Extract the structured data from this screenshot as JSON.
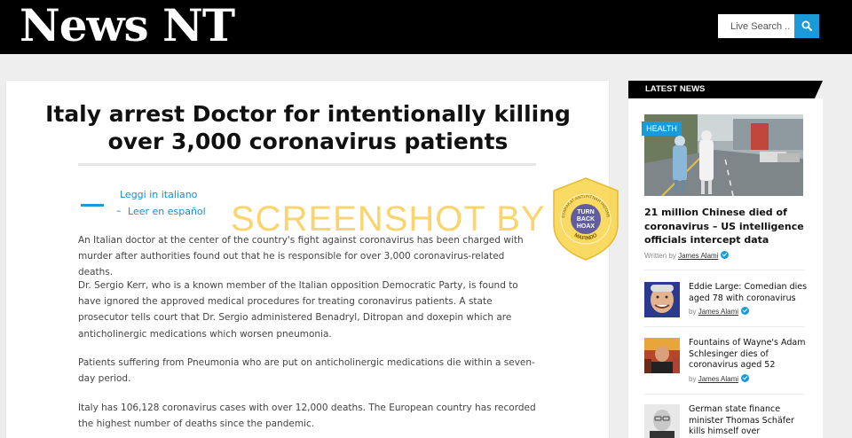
{
  "header": {
    "logo": "News NT",
    "search_placeholder": "Live Search ..",
    "search_icon": "magnifier-icon"
  },
  "article": {
    "title": "Italy arrest Doctor for intentionally killing over 3,000 coronavirus patients",
    "languages": [
      {
        "label": "Leggi in italiano"
      },
      {
        "label": "Leer en español"
      }
    ],
    "paragraphs": [
      "An Italian doctor at the center of the country's fight against coronavirus has been charged with murder after authorities found out that he is responsible for over 3,000 coronavirus-related deaths.",
      "Dr. Sergio Kerr, who is a known member of the Italian opposition Democratic Party, is found to have ignored the approved medical procedures for treating coronavirus patients. A state prosecutor tells court that Dr. Sergio administered Benadryl, Ditropan and doxepin which are anticholinergic medications which worsen pneumonia.",
      "Patients suffering from Pneumonia who are put on anticholinergic medications die within a seven-day period.",
      "Italy has 106,128 coronavirus cases with over 12,000 deaths. The European country has recorded the highest number of deaths since the pandemic."
    ]
  },
  "watermark": {
    "text": "SCREENSHOT BY",
    "seal_top": "MASYARAKAT ANTI FITNAH INDONESIA",
    "seal_center": [
      "TURN",
      "BACK",
      "HOAX"
    ],
    "seal_bottom": "MAFINDO"
  },
  "sidebar": {
    "heading": "LATEST NEWS",
    "featured": {
      "tag": "HEALTH",
      "title": "21 million Chinese died of coronavirus – US intelligence officials intercept data",
      "written_by": "Written by",
      "author": "James Alami"
    },
    "items": [
      {
        "title": "Eddie Large: Comedian dies aged 78 with coronavirus",
        "by": "by",
        "author": "James Alami"
      },
      {
        "title": "Fountains of Wayne's Adam Schlesinger dies of coronavirus aged 52",
        "by": "by",
        "author": "James Alami"
      },
      {
        "title": "German state finance minister Thomas Schäfer kills himself over",
        "by": "",
        "author": ""
      }
    ]
  },
  "colors": {
    "accent": "#1a9ad8",
    "header_bg": "#000000",
    "watermark": "#f8c846"
  }
}
